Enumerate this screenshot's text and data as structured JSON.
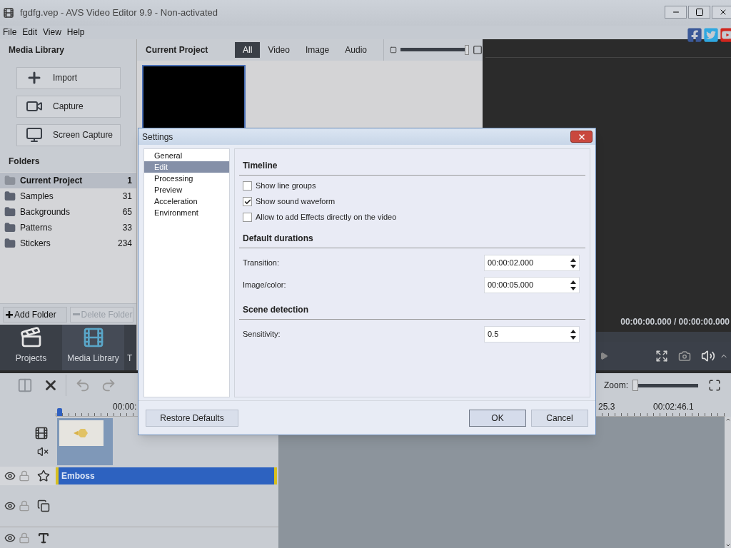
{
  "window": {
    "title": "fgdfg.vep - AVS Video Editor 9.9 - Non-activated"
  },
  "menu": [
    "File",
    "Edit",
    "View",
    "Help"
  ],
  "media_library": {
    "title": "Media Library",
    "actions": [
      {
        "label": "Import",
        "kind": "import"
      },
      {
        "label": "Capture",
        "kind": "capture"
      },
      {
        "label": "Screen Capture",
        "kind": "screen"
      }
    ],
    "folders_title": "Folders",
    "folders": [
      {
        "name": "Current Project",
        "count": "1",
        "selected": true
      },
      {
        "name": "Samples",
        "count": "31",
        "selected": false
      },
      {
        "name": "Backgrounds",
        "count": "65",
        "selected": false
      },
      {
        "name": "Patterns",
        "count": "33",
        "selected": false
      },
      {
        "name": "Stickers",
        "count": "234",
        "selected": false
      }
    ],
    "add_folder": {
      "label": "Add Folder",
      "disabled": false
    },
    "delete_folder": {
      "label": "Delete Folder",
      "disabled": true
    }
  },
  "nav_tabs": [
    {
      "label": "Projects",
      "kind": "projects",
      "selected": false
    },
    {
      "label": "Media Library",
      "kind": "library",
      "selected": true
    },
    {
      "label": "T",
      "kind": "other",
      "selected": false
    }
  ],
  "project": {
    "title": "Current Project",
    "filters": [
      {
        "label": "All",
        "selected": true
      },
      {
        "label": "Video",
        "selected": false
      },
      {
        "label": "Image",
        "selected": false
      },
      {
        "label": "Audio",
        "selected": false
      }
    ],
    "thumb_size": {
      "level": 1
    },
    "items": [
      {
        "selected": true
      }
    ]
  },
  "preview": {
    "time": "00:00:00.000 / 00:00:00.000"
  },
  "toolbar": {
    "zoom_label": "Zoom:",
    "zoom": {
      "level": 0
    }
  },
  "ruler": [
    "00:00:",
    "25.3",
    "00:02:46.1"
  ],
  "effect_clip": {
    "label": "Emboss"
  },
  "dialog": {
    "title": "Settings",
    "categories": [
      {
        "label": "General",
        "selected": false
      },
      {
        "label": "Edit",
        "selected": true
      },
      {
        "label": "Processing",
        "selected": false
      },
      {
        "label": "Preview",
        "selected": false
      },
      {
        "label": "Acceleration",
        "selected": false
      },
      {
        "label": "Environment",
        "selected": false
      }
    ],
    "sections": [
      {
        "title": "Timeline",
        "rows": [
          {
            "kind": "checkbox",
            "label": "Show line groups",
            "checked": false
          },
          {
            "kind": "checkbox",
            "label": "Show sound waveform",
            "checked": true
          },
          {
            "kind": "checkbox",
            "label": "Allow to add Effects directly on the video",
            "checked": false
          }
        ]
      },
      {
        "title": "Default durations",
        "rows": [
          {
            "kind": "spinner",
            "label": "Transition:",
            "value": "00:00:02.000"
          },
          {
            "kind": "spinner",
            "label": "Image/color:",
            "value": "00:00:05.000"
          }
        ]
      },
      {
        "title": "Scene detection",
        "rows": [
          {
            "kind": "spinner",
            "label": "Sensitivity:",
            "value": "0.5"
          }
        ]
      }
    ],
    "restore": "Restore Defaults",
    "ok": "OK",
    "cancel": "Cancel"
  }
}
